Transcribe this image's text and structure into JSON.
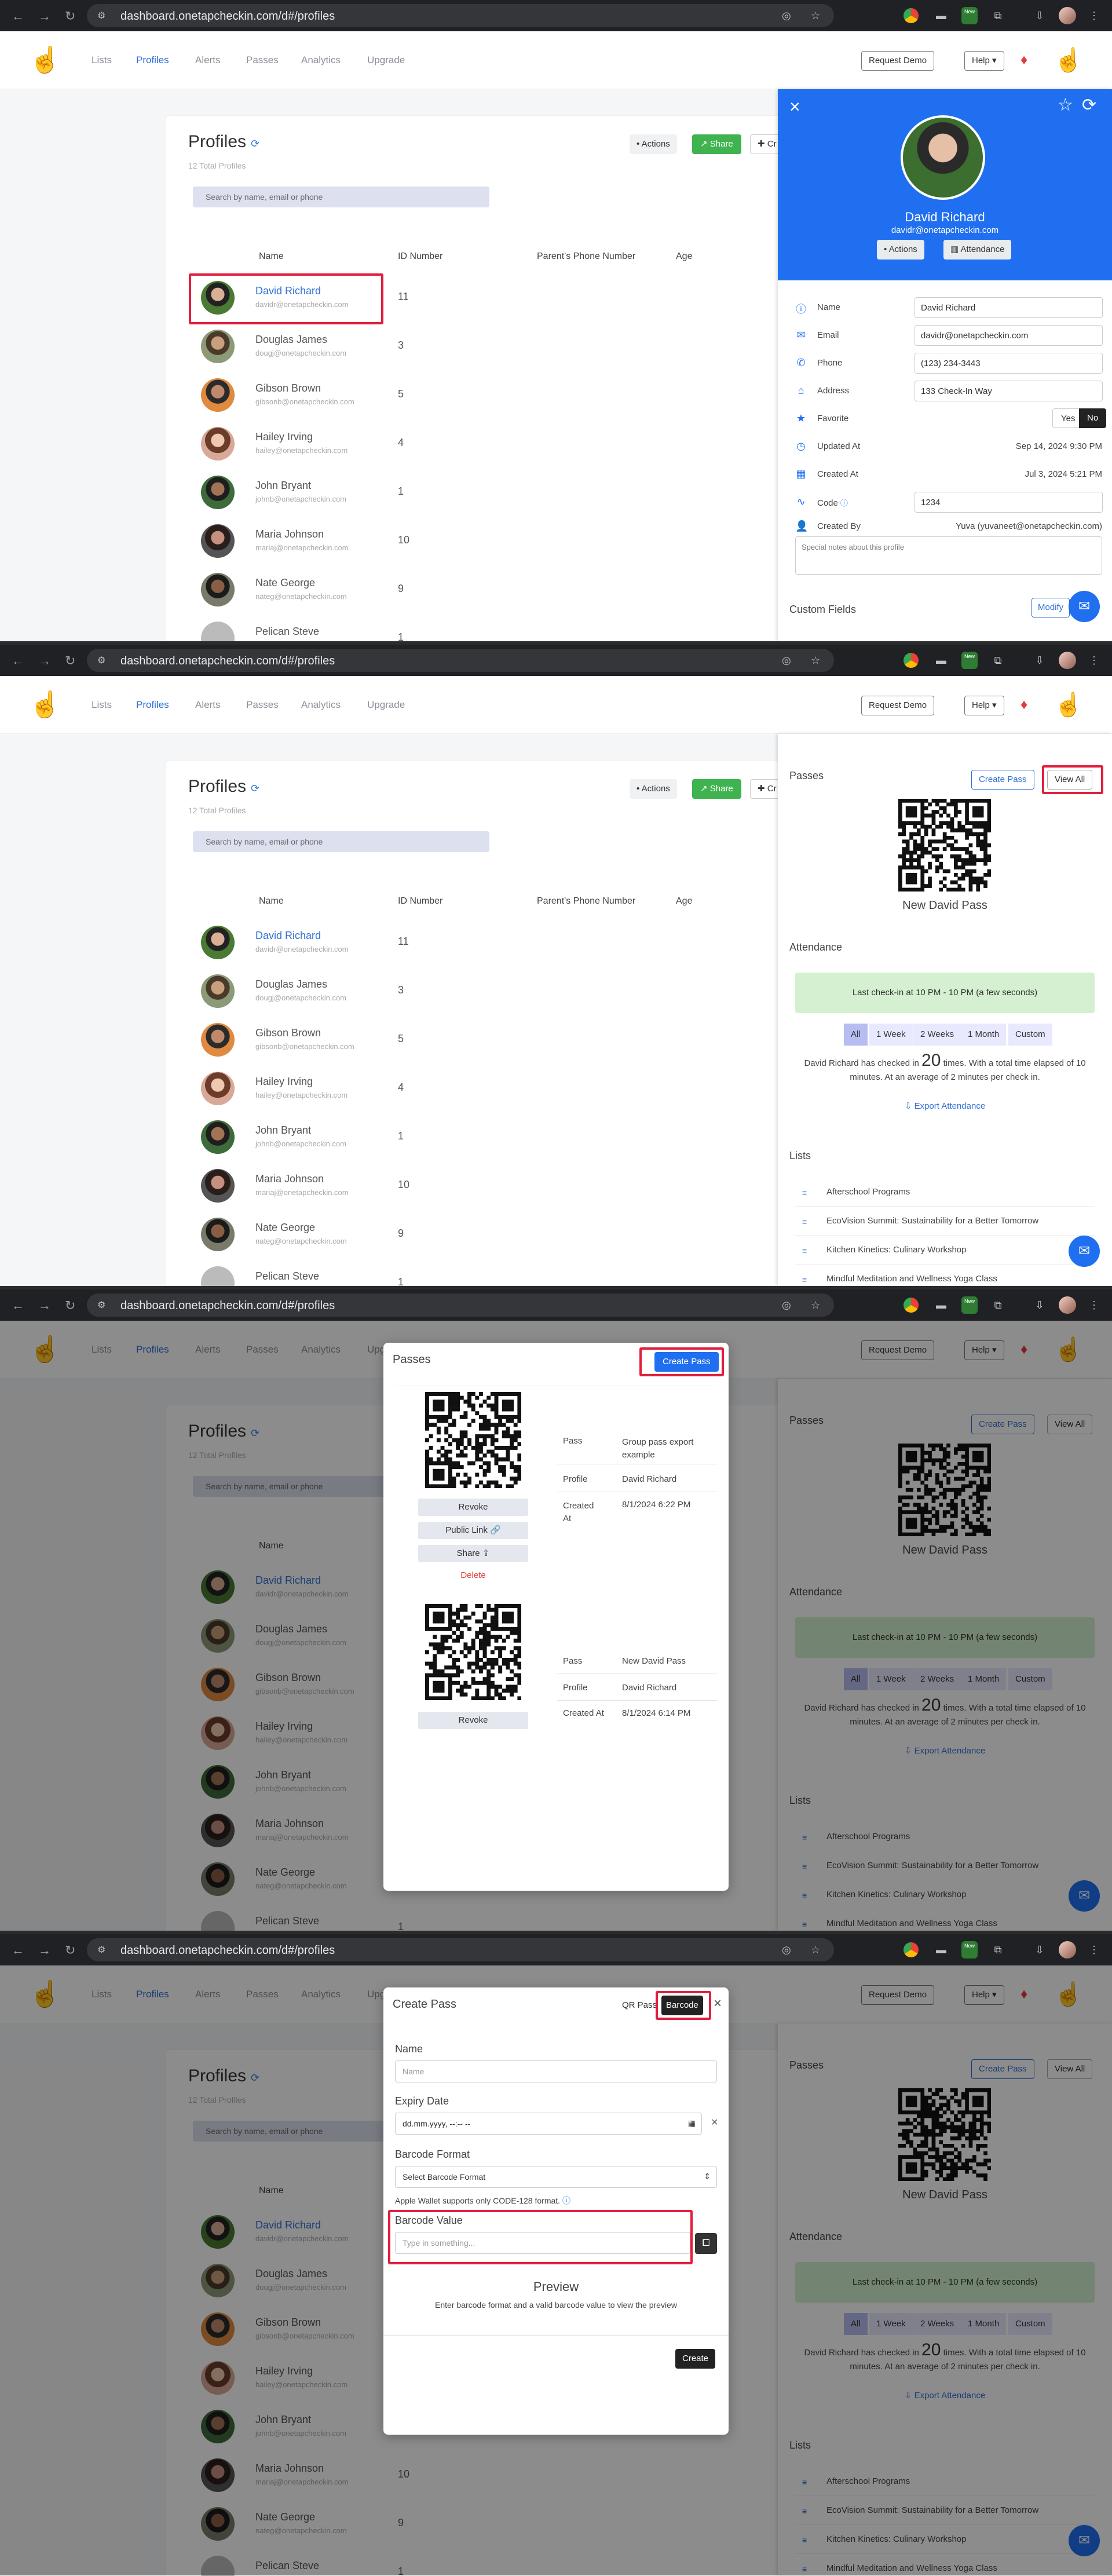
{
  "browser": {
    "url": "dashboard.onetapcheckin.com/d#/profiles",
    "new_badge": "New"
  },
  "app": {
    "menu": [
      "Lists",
      "Profiles",
      "Alerts",
      "Passes",
      "Analytics",
      "Upgrade"
    ],
    "request_demo": "Request Demo",
    "help": "Help ▾"
  },
  "profiles": {
    "title": "Profiles",
    "subtitle": "12 Total Profiles",
    "search_placeholder": "Search by name, email or phone",
    "actions": "Actions",
    "share": "Share",
    "create": "Cr",
    "columns": [
      "Name",
      "ID Number",
      "Parent's Phone Number",
      "Age"
    ],
    "rows": [
      {
        "name": "David Richard",
        "email": "davidr@onetapcheckin.com",
        "id": "11"
      },
      {
        "name": "Douglas James",
        "email": "dougj@onetapcheckin.com",
        "id": "3"
      },
      {
        "name": "Gibson Brown",
        "email": "gibsonb@onetapcheckin.com",
        "id": "5"
      },
      {
        "name": "Hailey Irving",
        "email": "hailey@onetapcheckin.com",
        "id": "4"
      },
      {
        "name": "John Bryant",
        "email": "johnb@onetapcheckin.com",
        "id": "1"
      },
      {
        "name": "Maria Johnson",
        "email": "mariaj@onetapcheckin.com",
        "id": "10"
      },
      {
        "name": "Nate George",
        "email": "nateg@onetapcheckin.com",
        "id": "9"
      },
      {
        "name": "Pelican Steve",
        "email": "",
        "id": "1"
      }
    ]
  },
  "drawer": {
    "name": "David Richard",
    "email": "davidr@onetapcheckin.com",
    "actions": "Actions",
    "attendance_btn": "Attendance",
    "fields": {
      "name_label": "Name",
      "name_value": "David Richard",
      "email_label": "Email",
      "email_value": "davidr@onetapcheckin.com",
      "phone_label": "Phone",
      "phone_value": "(123) 234-3443",
      "address_label": "Address",
      "address_value": "133 Check-In Way",
      "favorite_label": "Favorite",
      "yes": "Yes",
      "no": "No",
      "updated_label": "Updated At",
      "updated_value": "Sep 14, 2024 9:30 PM",
      "created_label": "Created At",
      "created_value": "Jul 3, 2024 5:21 PM",
      "code_label": "Code",
      "code_value": "1234",
      "createdby_label": "Created By",
      "createdby_value": "Yuva (yuvaneet@onetapcheckin.com)"
    },
    "notes_placeholder": "Special notes about this profile",
    "custom_fields": "Custom Fields",
    "modify": "Modify"
  },
  "drawer2": {
    "passes_title": "Passes",
    "create_pass": "Create Pass",
    "view_all": "View All",
    "pass_caption": "New David Pass",
    "attendance_title": "Attendance",
    "last_checkin": "Last check-in at 10 PM - 10 PM (a few seconds)",
    "ranges": [
      "All",
      "1 Week",
      "2 Weeks",
      "1 Month",
      "Custom"
    ],
    "att_pre": "David Richard has checked in",
    "att_count": "20",
    "att_post": "times. With a total time elapsed of 10 minutes. At an average of 2 minutes per check in.",
    "export": "Export Attendance",
    "lists_title": "Lists",
    "lists": [
      "Afterschool Programs",
      "EcoVision Summit: Sustainability for a Better Tomorrow",
      "Kitchen Kinetics: Culinary Workshop",
      "Mindful Meditation and Wellness Yoga Class"
    ]
  },
  "passes_modal": {
    "title": "Passes",
    "create_pass": "Create Pass",
    "revoke": "Revoke",
    "public_link": "Public Link 🔗",
    "share": "Share ⇪",
    "delete": "Delete",
    "pass_label": "Pass",
    "profile_label": "Profile",
    "created_label": "Created At",
    "pass1": {
      "name": "Group pass export example",
      "profile": "David Richard",
      "created": "8/1/2024 6:22 PM"
    },
    "pass2": {
      "name": "New David Pass",
      "profile": "David Richard",
      "created": "8/1/2024 6:14 PM"
    }
  },
  "create_modal": {
    "title": "Create Pass",
    "qr_tab": "QR Pass",
    "barcode_tab": "Barcode",
    "name_label": "Name",
    "name_placeholder": "Name",
    "expiry_label": "Expiry Date",
    "expiry_placeholder": "dd.mm.yyyy, --:-- --",
    "format_label": "Barcode Format",
    "format_placeholder": "Select Barcode Format",
    "wallet_note": "Apple Wallet supports only CODE-128 format.",
    "value_label": "Barcode Value",
    "value_placeholder": "Type in something...",
    "preview_title": "Preview",
    "preview_text": "Enter barcode format and a valid barcode value to view the preview",
    "create_btn": "Create"
  }
}
